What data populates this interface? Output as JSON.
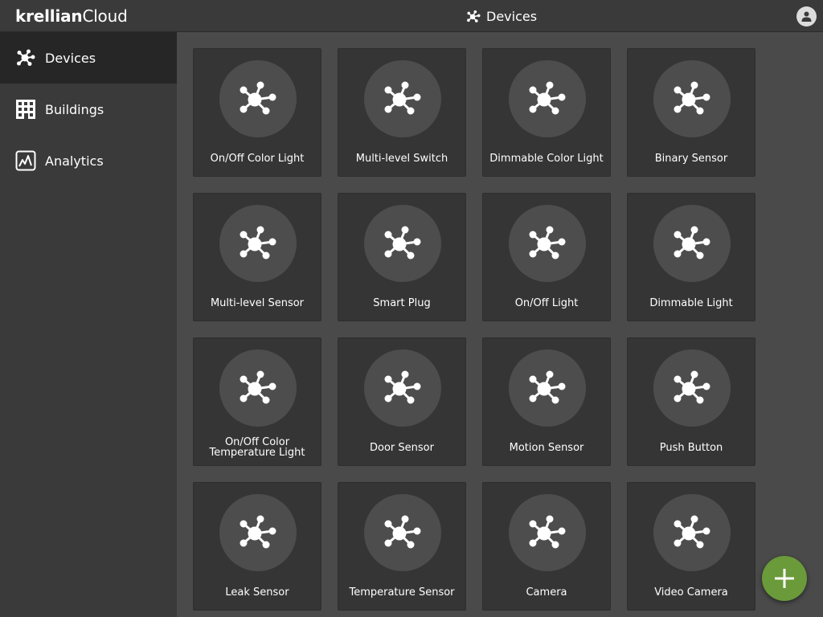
{
  "app": {
    "brand_bold": "krellian",
    "brand_regular": "Cloud",
    "page_title": "Devices"
  },
  "header": {
    "title_icon": "device-hub-icon",
    "user_icon": "user-icon"
  },
  "sidebar": {
    "items": [
      {
        "label": "Devices",
        "icon": "device-hub-icon",
        "active": true
      },
      {
        "label": "Buildings",
        "icon": "building-icon",
        "active": false
      },
      {
        "label": "Analytics",
        "icon": "analytics-icon",
        "active": false
      }
    ]
  },
  "devices": [
    {
      "label": "On/Off Color Light"
    },
    {
      "label": "Multi-level Switch"
    },
    {
      "label": "Dimmable Color Light"
    },
    {
      "label": "Binary Sensor"
    },
    {
      "label": "Multi-level Sensor"
    },
    {
      "label": "Smart Plug"
    },
    {
      "label": "On/Off Light"
    },
    {
      "label": "Dimmable Light"
    },
    {
      "label": "On/Off Color Temperature Light"
    },
    {
      "label": "Door Sensor"
    },
    {
      "label": "Motion Sensor"
    },
    {
      "label": "Push Button"
    },
    {
      "label": "Leak Sensor"
    },
    {
      "label": "Temperature Sensor"
    },
    {
      "label": "Camera"
    },
    {
      "label": "Video Camera"
    }
  ],
  "fab": {
    "icon": "plus-icon"
  },
  "colors": {
    "topbar": "#3a3a3a",
    "sidebar": "#3a3a3a",
    "sidebar_active": "#262626",
    "content_bg": "#4a4a4a",
    "tile_bg": "#353535",
    "tile_circle": "#4d4d4d",
    "fab": "#6a9a3a"
  }
}
